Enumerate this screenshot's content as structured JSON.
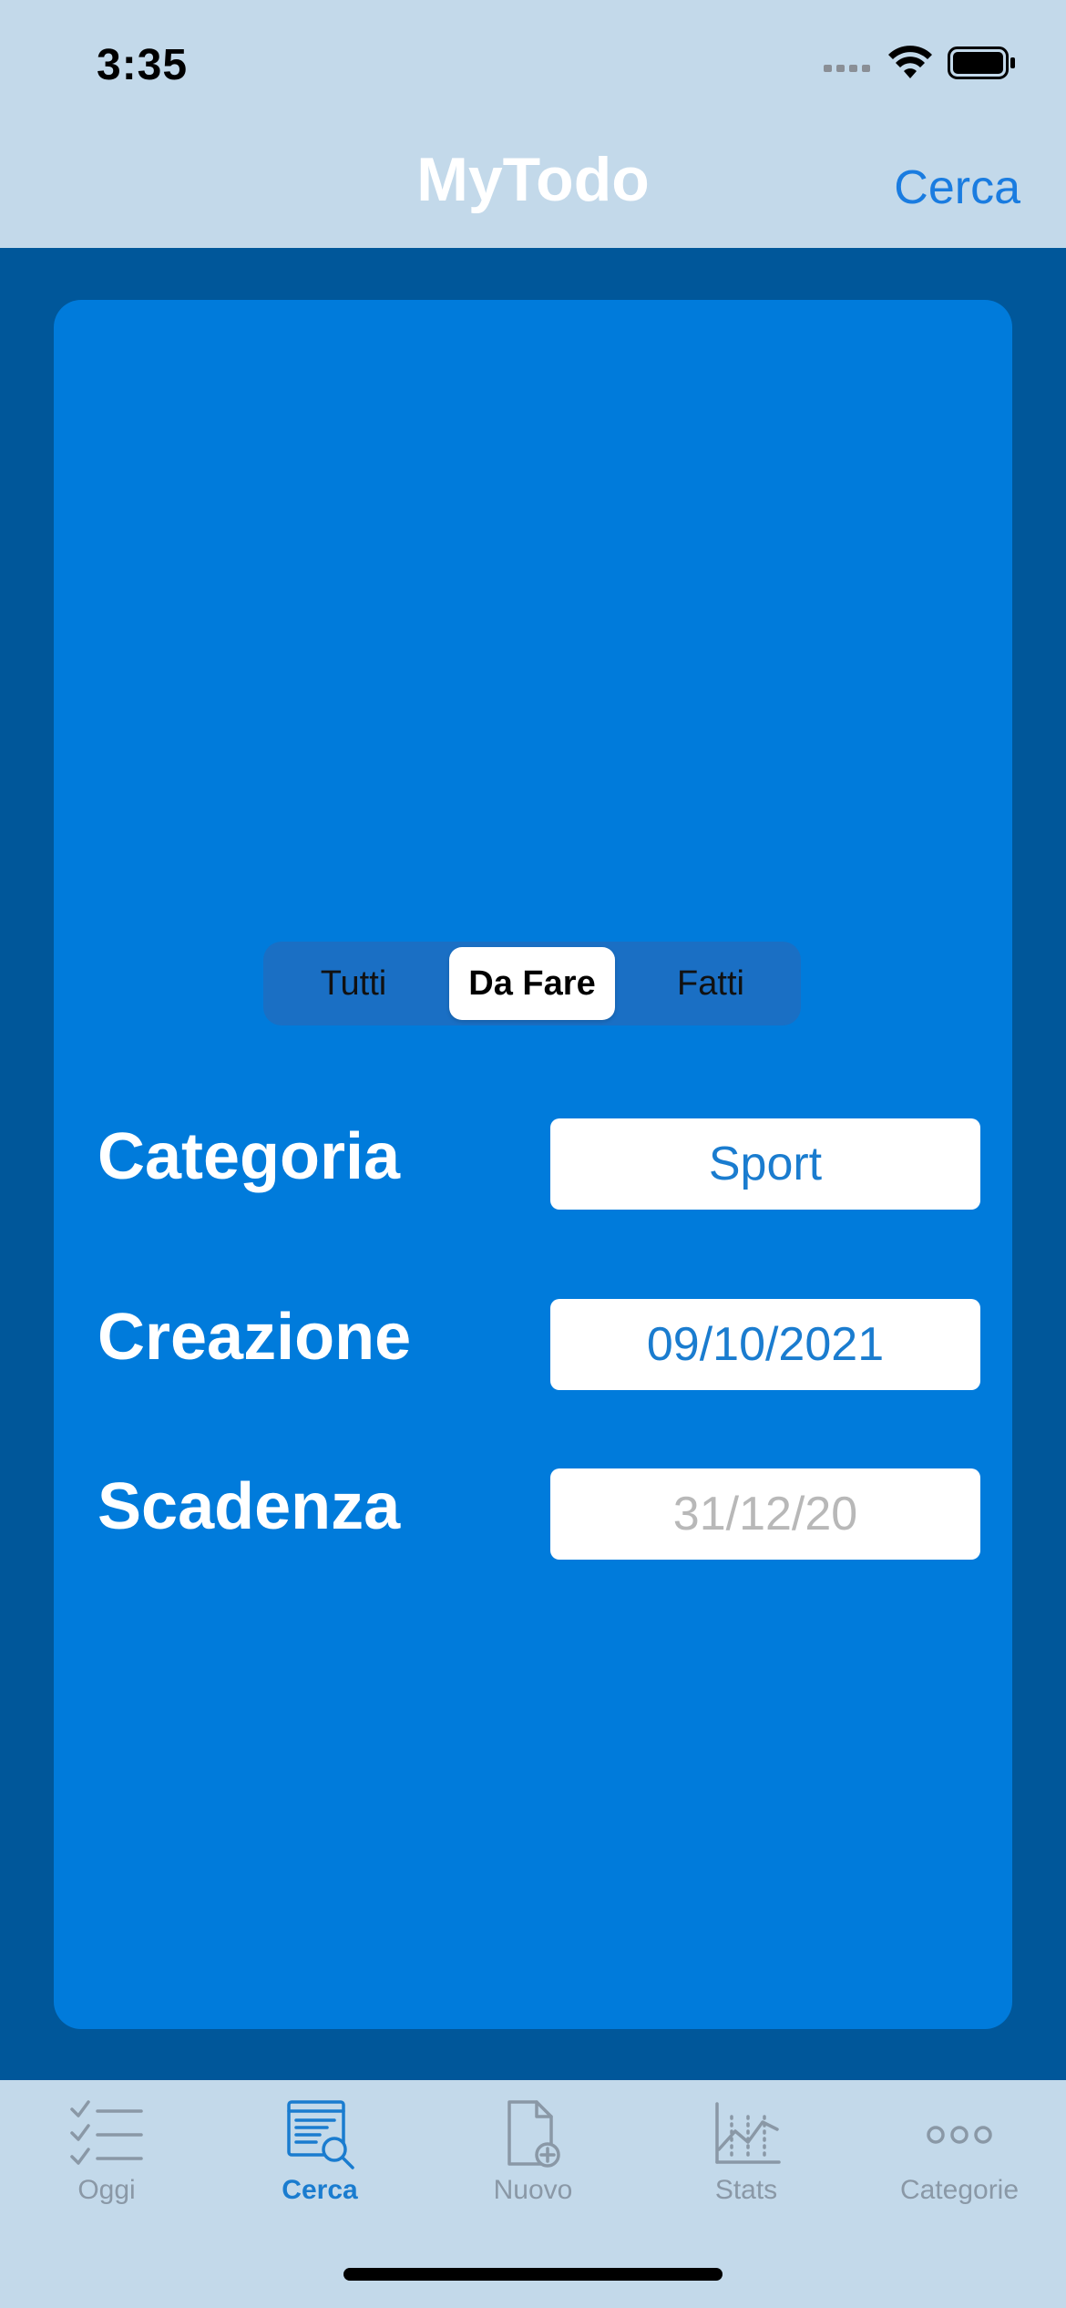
{
  "status_bar": {
    "time": "3:35",
    "icons": [
      "cellular-signal-icon",
      "wifi-icon",
      "battery-icon"
    ]
  },
  "nav": {
    "title": "MyTodo",
    "action": "Cerca"
  },
  "filter": {
    "segments": [
      "Tutti",
      "Da Fare",
      "Fatti"
    ],
    "selected": "Da Fare"
  },
  "fields": {
    "category": {
      "label": "Categoria",
      "value": "Sport"
    },
    "created": {
      "label": "Creazione",
      "value": "09/10/2021"
    },
    "due": {
      "label": "Scadenza",
      "placeholder": "31/12/20"
    }
  },
  "tabbar": {
    "items": [
      {
        "label": "Oggi",
        "icon": "checklist-icon"
      },
      {
        "label": "Cerca",
        "icon": "search-document-icon"
      },
      {
        "label": "Nuovo",
        "icon": "new-document-icon"
      },
      {
        "label": "Stats",
        "icon": "chart-icon"
      },
      {
        "label": "Categorie",
        "icon": "more-icon"
      }
    ],
    "active": "Cerca"
  },
  "colors": {
    "background": "#00579a",
    "card": "#007bdb",
    "bars": "#c3d9ea",
    "accent": "#1a7ccf"
  }
}
